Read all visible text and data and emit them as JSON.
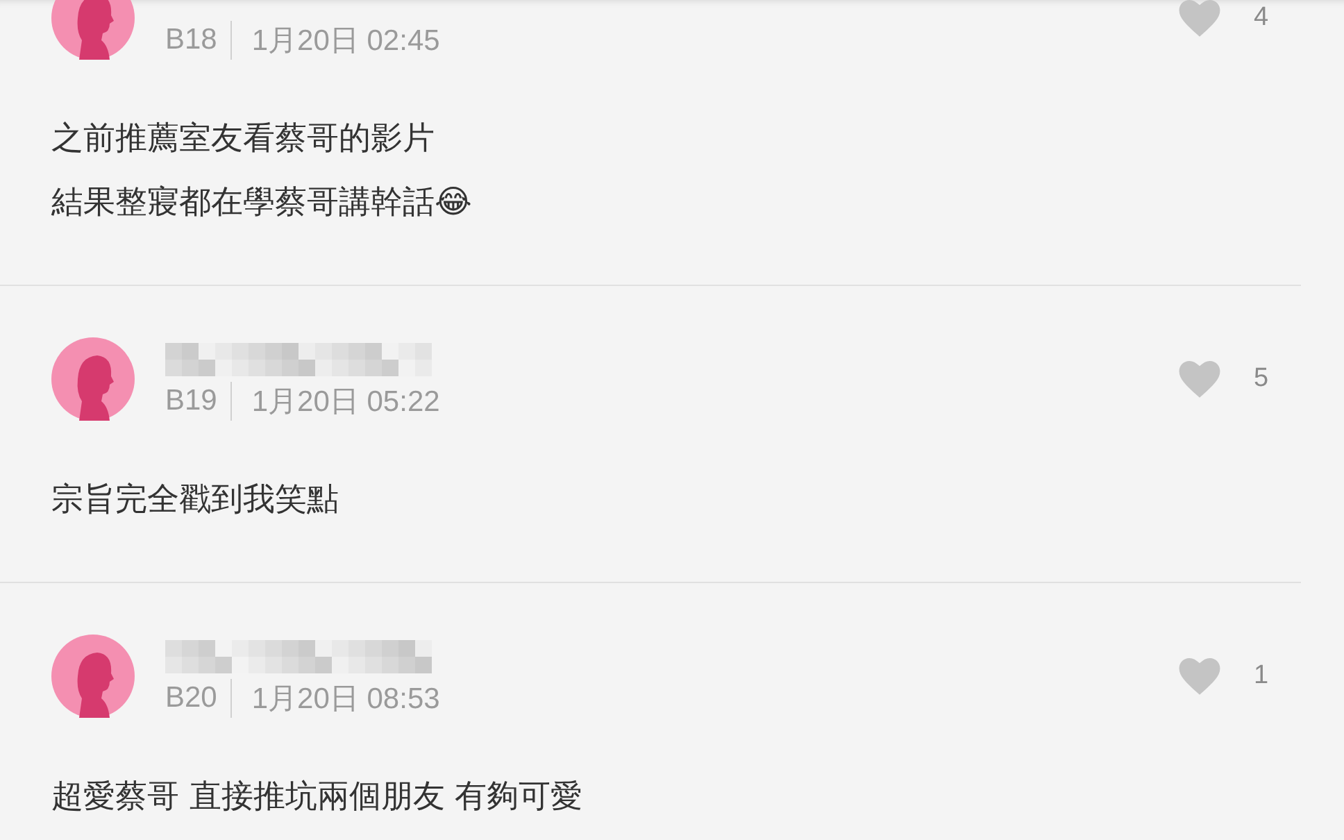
{
  "comments": [
    {
      "floor": "B18",
      "time": "1月20日 02:45",
      "likes": "4",
      "body": [
        "之前推薦室友看蔡哥的影片",
        "結果整寢都在學蔡哥講幹話😂"
      ],
      "name_hidden": false
    },
    {
      "floor": "B19",
      "time": "1月20日 05:22",
      "likes": "5",
      "body": [
        "宗旨完全戳到我笑點"
      ],
      "name_hidden": true
    },
    {
      "floor": "B20",
      "time": "1月20日 08:53",
      "likes": "1",
      "body": [
        "超愛蔡哥 直接推坑兩個朋友 有夠可愛"
      ],
      "name_hidden": true
    }
  ]
}
